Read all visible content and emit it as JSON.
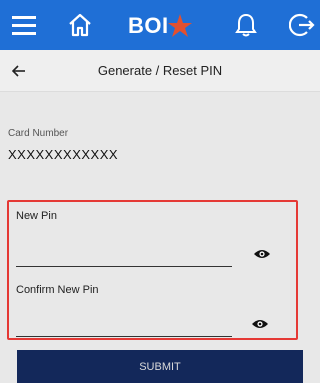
{
  "header": {
    "logo_text": "BOI",
    "brand_color": "#1f6fd6",
    "logo_star_color": "#e2502f",
    "icons": [
      "menu-icon",
      "home-icon",
      "bell-icon",
      "logout-icon"
    ]
  },
  "title_bar": {
    "title": "Generate / Reset PIN",
    "back_icon": "back-arrow-icon"
  },
  "card": {
    "label": "Card Number",
    "value": "XXXXXXXXXXXX"
  },
  "pin_form": {
    "new_pin_label": "New Pin",
    "new_pin_value": "",
    "confirm_pin_label": "Confirm New Pin",
    "confirm_pin_value": "",
    "eye_icon": "eye-icon",
    "highlight_color": "#e53935"
  },
  "submit": {
    "label": "SUBMIT",
    "color": "#13285a"
  }
}
